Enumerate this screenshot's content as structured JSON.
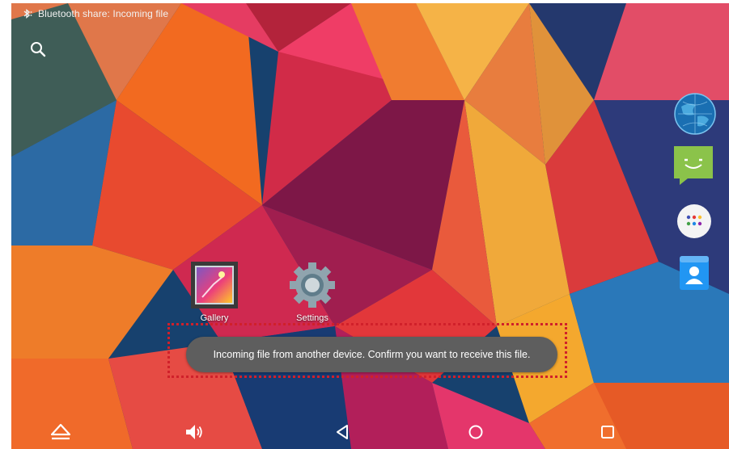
{
  "status_bar": {
    "notification_icon": "bluetooth-icon",
    "notification_text": "Bluetooth share: Incoming file"
  },
  "home_screen": {
    "search_icon": "search-icon",
    "desktop_apps": [
      {
        "label": "Gallery",
        "icon": "gallery-icon"
      },
      {
        "label": "Settings",
        "icon": "gear-icon"
      }
    ],
    "dock_apps": [
      {
        "icon": "globe-icon"
      },
      {
        "icon": "messaging-icon"
      },
      {
        "icon": "app-drawer-icon"
      },
      {
        "icon": "contacts-icon"
      }
    ]
  },
  "toast": {
    "message": "Incoming file from another device. Confirm you want to receive this file.",
    "highlight_color": "#d0202a"
  },
  "nav_bar": {
    "buttons": [
      {
        "icon": "hide-bar-icon"
      },
      {
        "icon": "volume-icon"
      },
      {
        "icon": "back-icon"
      },
      {
        "icon": "home-icon"
      },
      {
        "icon": "recents-icon"
      }
    ]
  }
}
